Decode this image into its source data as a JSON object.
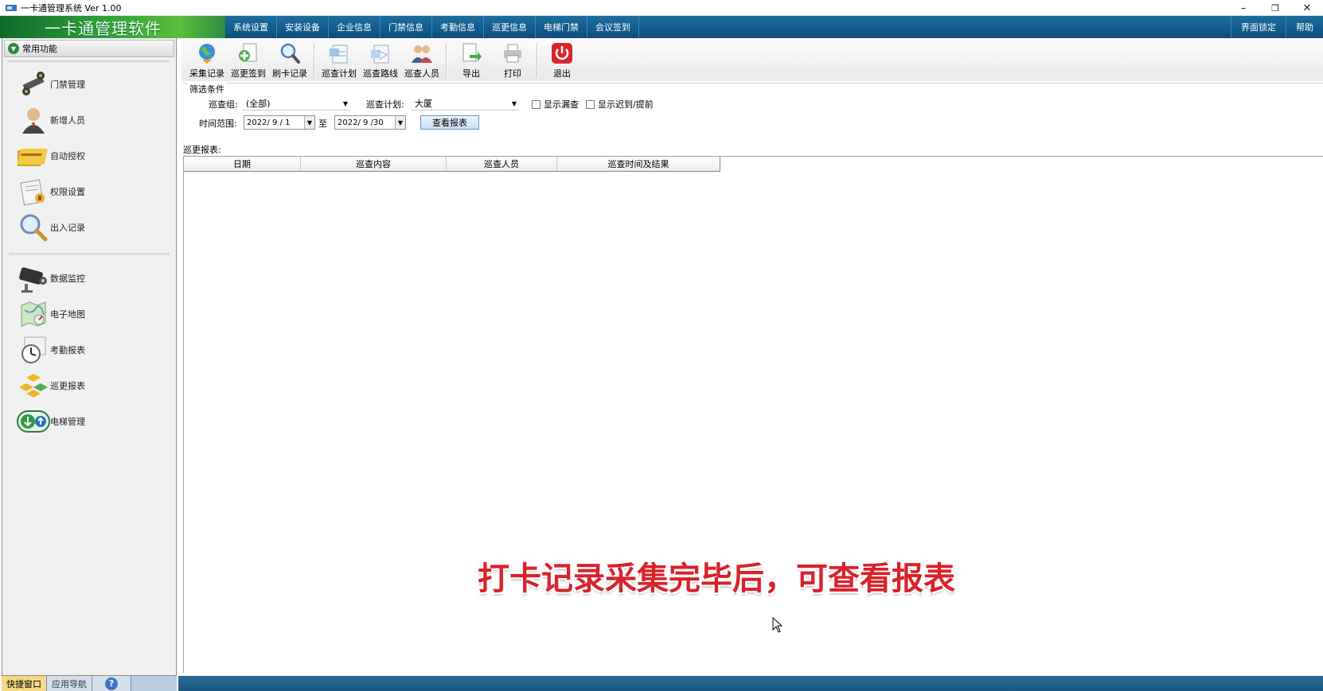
{
  "window": {
    "title": "一卡通管理系统  Ver 1.00",
    "minimize_glyph": "–",
    "restore_glyph": "❐",
    "close_glyph": "✕"
  },
  "header": {
    "logo_text": "一卡通管理软件",
    "menu": [
      "系统设置",
      "安装设备",
      "企业信息",
      "门禁信息",
      "考勤信息",
      "巡更信息",
      "电梯门禁",
      "会议签到"
    ],
    "right_menu": [
      "界面锁定",
      "帮助"
    ]
  },
  "sidebar": {
    "title": "常用功能",
    "group1": [
      {
        "label": "门禁管理",
        "icon": "door-control-icon"
      },
      {
        "label": "新增人员",
        "icon": "person-icon"
      },
      {
        "label": "自动授权",
        "icon": "card-icon"
      },
      {
        "label": "权限设置",
        "icon": "permission-icon"
      },
      {
        "label": "出入记录",
        "icon": "magnifier-icon"
      }
    ],
    "group2": [
      {
        "label": "数据监控",
        "icon": "camera-icon"
      },
      {
        "label": "电子地图",
        "icon": "map-icon"
      },
      {
        "label": "考勤报表",
        "icon": "clock-icon"
      },
      {
        "label": "巡更报表",
        "icon": "blocks-icon"
      },
      {
        "label": "电梯管理",
        "icon": "elevator-icon"
      }
    ],
    "tabs": [
      "快捷窗口",
      "应用导航"
    ],
    "help_glyph": "?"
  },
  "toolbar": {
    "buttons": [
      {
        "label": "采集记录",
        "icon": "globe-icon"
      },
      {
        "label": "巡更签到",
        "icon": "add-doc-icon"
      },
      {
        "label": "刷卡记录",
        "icon": "search-doc-icon"
      },
      {
        "label": "巡查计划",
        "icon": "plan-icon"
      },
      {
        "label": "巡查路线",
        "icon": "route-icon"
      },
      {
        "label": "巡查人员",
        "icon": "people-icon"
      },
      {
        "label": "导出",
        "icon": "export-icon"
      },
      {
        "label": "打印",
        "icon": "printer-icon"
      },
      {
        "label": "退出",
        "icon": "power-icon"
      }
    ]
  },
  "filter": {
    "title": "筛选条件",
    "group_label": "巡查组:",
    "group_value": "(全部)",
    "plan_label": "巡查计划:",
    "plan_value": "大厦",
    "show_missed": "显示漏查",
    "show_late": "显示迟到/提前",
    "range_label": "时间范围:",
    "date_from": "2022/ 9 / 1",
    "to_label": "至",
    "date_to": "2022/ 9 /30",
    "view_button": "查看报表"
  },
  "report": {
    "label": "巡更报表:",
    "columns": [
      "日期",
      "巡查内容",
      "巡查人员",
      "巡查时间及结果"
    ]
  },
  "overlay": {
    "caption": "打卡记录采集完毕后，可查看报表"
  },
  "colors": {
    "menu_bar": "#0d4d7c",
    "logo_green": "#2f9e3a",
    "caption_red": "#d9222a",
    "status_bar": "#1b5680"
  }
}
